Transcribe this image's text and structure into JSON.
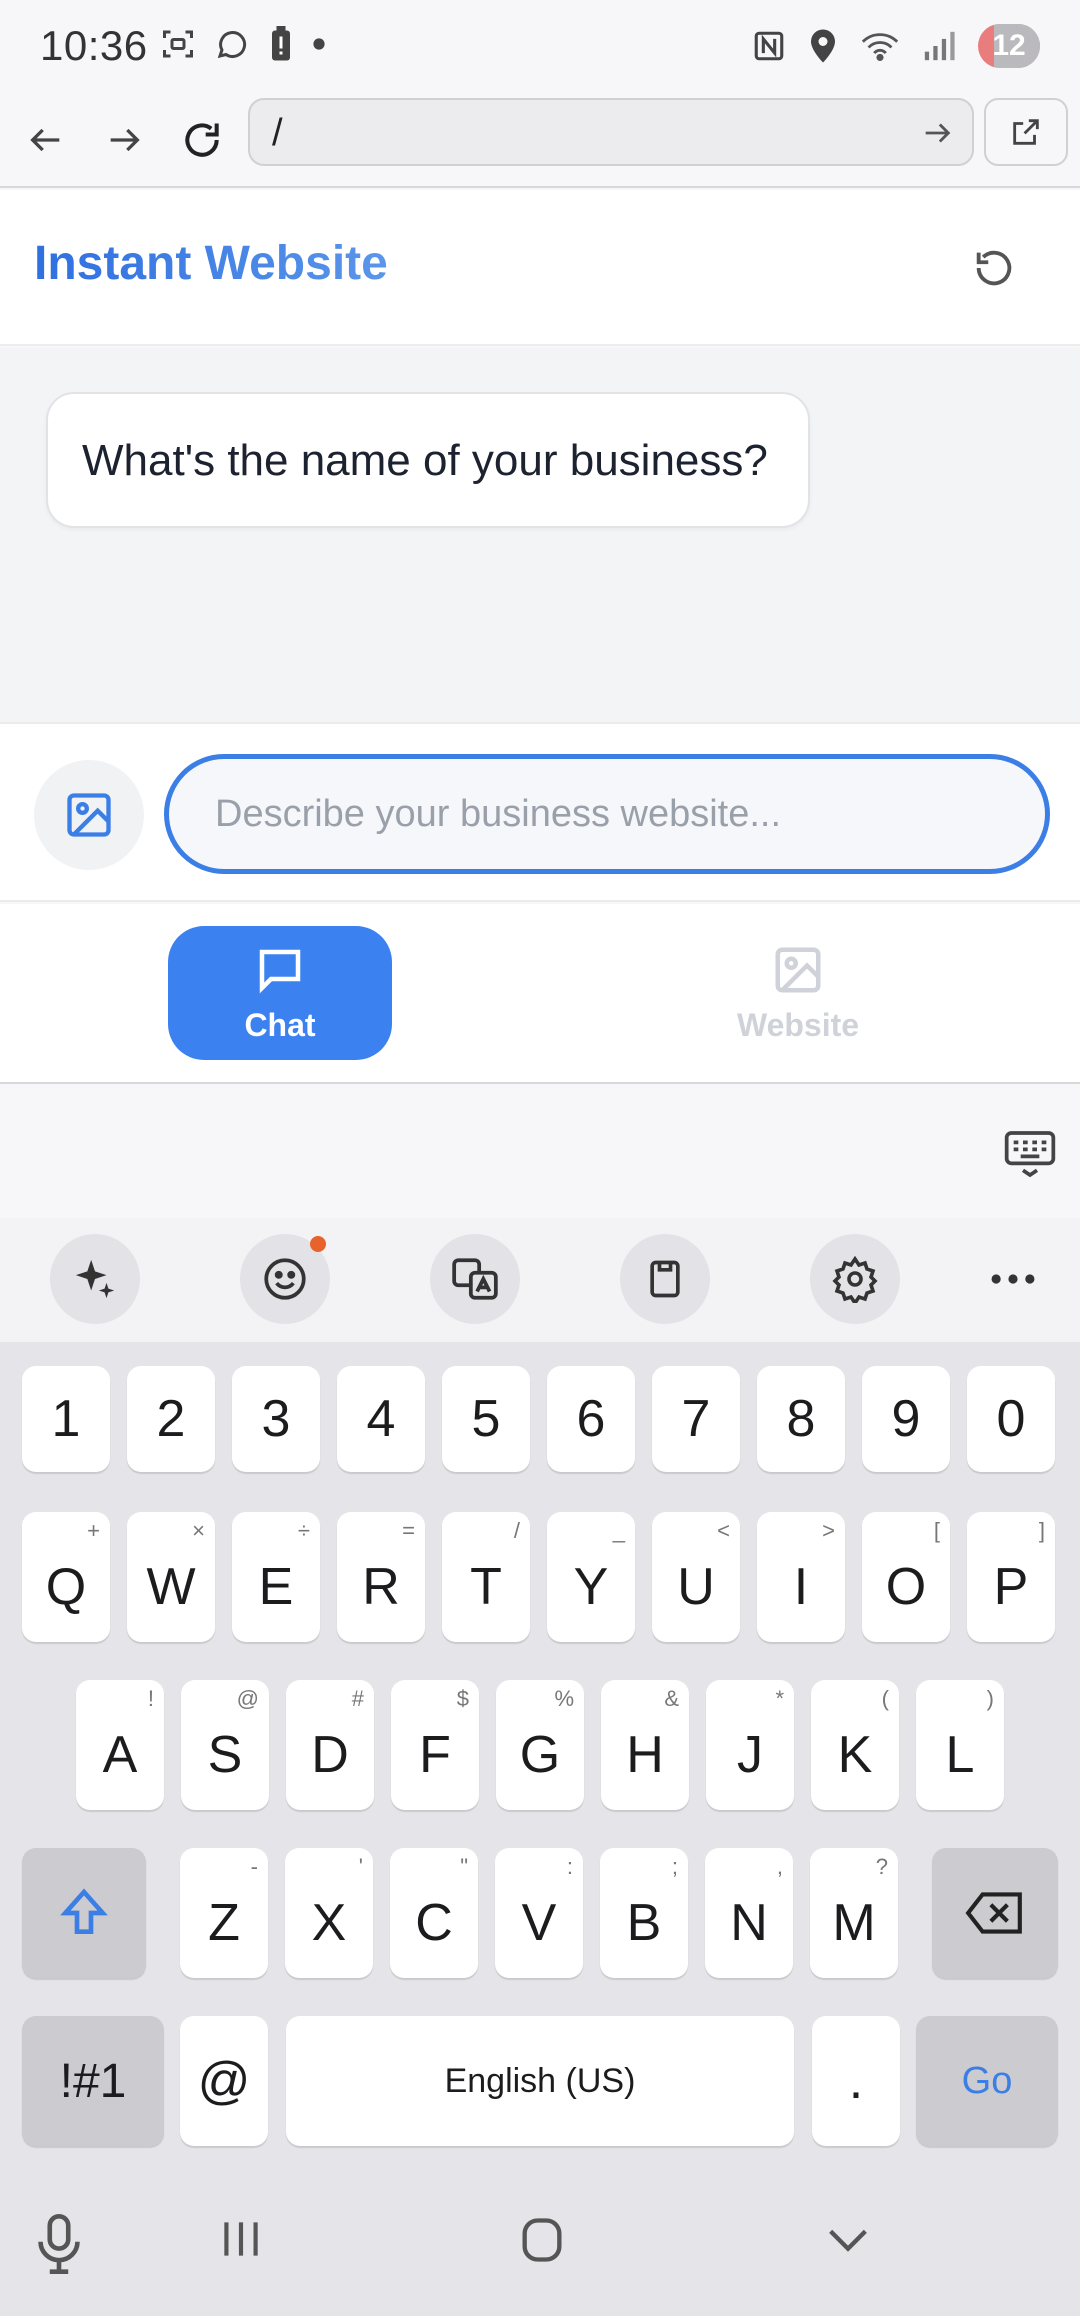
{
  "status_bar": {
    "time": "10:36",
    "battery": "12",
    "left_icons": [
      "screenshot-icon",
      "whatsapp-icon",
      "battery-alert-icon",
      "dot-icon"
    ],
    "right_icons": [
      "nfc-icon",
      "location-icon",
      "wifi-icon",
      "signal-icon"
    ]
  },
  "browser": {
    "url": "/"
  },
  "app": {
    "title": "Instant Website",
    "accent_color": "#3b82f0"
  },
  "chat": {
    "messages": [
      {
        "role": "assistant",
        "text": "What's the name of your business?"
      }
    ]
  },
  "composer": {
    "placeholder": "Describe your business website...",
    "value": ""
  },
  "tabs": [
    {
      "label": "Chat",
      "active": true
    },
    {
      "label": "Website",
      "active": false
    }
  ],
  "keyboard": {
    "number_row": [
      "1",
      "2",
      "3",
      "4",
      "5",
      "6",
      "7",
      "8",
      "9",
      "0"
    ],
    "row1": [
      {
        "k": "Q",
        "s": "+"
      },
      {
        "k": "W",
        "s": "×"
      },
      {
        "k": "E",
        "s": "÷"
      },
      {
        "k": "R",
        "s": "="
      },
      {
        "k": "T",
        "s": "/"
      },
      {
        "k": "Y",
        "s": "_"
      },
      {
        "k": "U",
        "s": "<"
      },
      {
        "k": "I",
        "s": ">"
      },
      {
        "k": "O",
        "s": "["
      },
      {
        "k": "P",
        "s": "]"
      }
    ],
    "row2": [
      {
        "k": "A",
        "s": "!"
      },
      {
        "k": "S",
        "s": "@"
      },
      {
        "k": "D",
        "s": "#"
      },
      {
        "k": "F",
        "s": "$"
      },
      {
        "k": "G",
        "s": "%"
      },
      {
        "k": "H",
        "s": "&"
      },
      {
        "k": "J",
        "s": "*"
      },
      {
        "k": "K",
        "s": "("
      },
      {
        "k": "L",
        "s": ")"
      }
    ],
    "row3": [
      {
        "k": "Z",
        "s": "-"
      },
      {
        "k": "X",
        "s": "'"
      },
      {
        "k": "C",
        "s": "\""
      },
      {
        "k": "V",
        "s": ":"
      },
      {
        "k": "B",
        "s": ";"
      },
      {
        "k": "N",
        "s": ","
      },
      {
        "k": "M",
        "s": "?"
      }
    ],
    "symbols_label": "!#1",
    "at_label": "@",
    "space_label": "English (US)",
    "period_label": ".",
    "go_label": "Go"
  }
}
